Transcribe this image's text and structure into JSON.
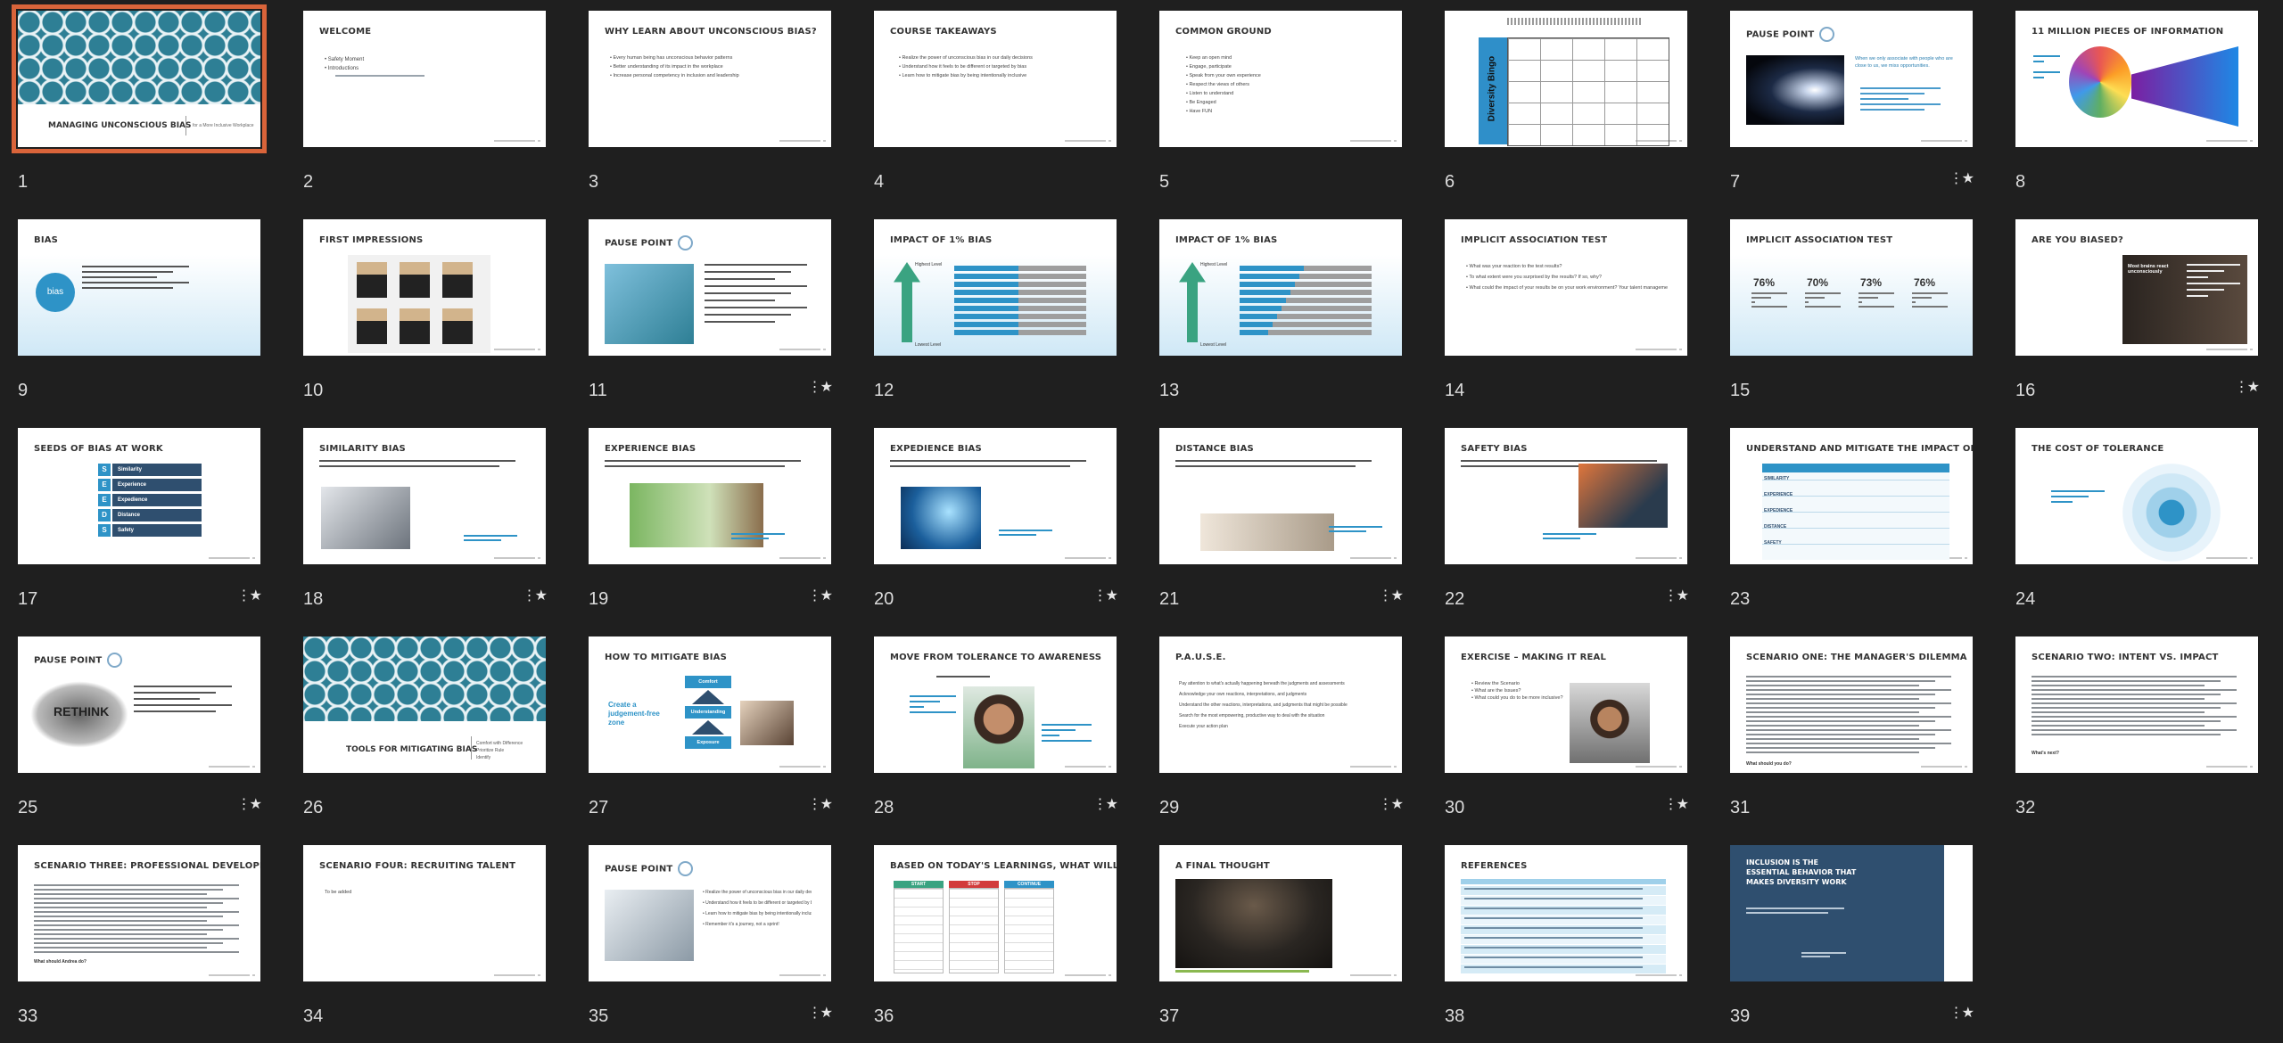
{
  "selected_slide": 1,
  "slides": [
    {
      "n": "1",
      "title": "MANAGING UNCONSCIOUS BIAS",
      "subtitle": "for a More Inclusive Workplace",
      "star": false
    },
    {
      "n": "2",
      "title": "WELCOME",
      "star": false
    },
    {
      "n": "3",
      "title": "WHY LEARN ABOUT UNCONSCIOUS BIAS?",
      "star": false
    },
    {
      "n": "4",
      "title": "COURSE TAKEAWAYS",
      "star": false
    },
    {
      "n": "5",
      "title": "COMMON GROUND",
      "star": false
    },
    {
      "n": "6",
      "title": "Diversity Bingo",
      "star": false
    },
    {
      "n": "7",
      "title": "PAUSE POINT",
      "star": true
    },
    {
      "n": "8",
      "title": "11 MILLION PIECES OF INFORMATION",
      "star": false
    },
    {
      "n": "9",
      "title": "BIAS",
      "star": false
    },
    {
      "n": "10",
      "title": "FIRST IMPRESSIONS",
      "star": false
    },
    {
      "n": "11",
      "title": "PAUSE POINT",
      "star": true
    },
    {
      "n": "12",
      "title": "IMPACT OF 1% BIAS",
      "star": false
    },
    {
      "n": "13",
      "title": "IMPACT OF 1% BIAS",
      "star": false
    },
    {
      "n": "14",
      "title": "IMPLICIT ASSOCIATION TEST",
      "star": false
    },
    {
      "n": "15",
      "title": "IMPLICIT ASSOCIATION TEST",
      "star": false
    },
    {
      "n": "16",
      "title": "ARE YOU BIASED?",
      "star": true
    },
    {
      "n": "17",
      "title": "SEEDS OF BIAS AT WORK",
      "star": true
    },
    {
      "n": "18",
      "title": "SIMILARITY BIAS",
      "star": true
    },
    {
      "n": "19",
      "title": "EXPERIENCE BIAS",
      "star": true
    },
    {
      "n": "20",
      "title": "EXPEDIENCE BIAS",
      "star": true
    },
    {
      "n": "21",
      "title": "DISTANCE BIAS",
      "star": true
    },
    {
      "n": "22",
      "title": "SAFETY BIAS",
      "star": true
    },
    {
      "n": "23",
      "title": "UNDERSTAND AND MITIGATE THE IMPACT OF BIAS",
      "star": false
    },
    {
      "n": "24",
      "title": "THE COST OF TOLERANCE",
      "star": false
    },
    {
      "n": "25",
      "title": "PAUSE POINT",
      "star": true
    },
    {
      "n": "26",
      "title": "TOOLS FOR MITIGATING BIAS",
      "star": false
    },
    {
      "n": "27",
      "title": "HOW TO MITIGATE BIAS",
      "star": true
    },
    {
      "n": "28",
      "title": "MOVE FROM TOLERANCE TO AWARENESS",
      "star": true
    },
    {
      "n": "29",
      "title": "P.A.U.S.E.",
      "star": true
    },
    {
      "n": "30",
      "title": "EXERCISE – MAKING IT REAL",
      "star": true
    },
    {
      "n": "31",
      "title": "SCENARIO ONE: THE MANAGER'S DILEMMA",
      "star": false
    },
    {
      "n": "32",
      "title": "SCENARIO TWO: INTENT VS. IMPACT",
      "star": false
    },
    {
      "n": "33",
      "title": "SCENARIO THREE: PROFESSIONAL DEVELOPMENT",
      "star": false
    },
    {
      "n": "34",
      "title": "SCENARIO FOUR: RECRUITING TALENT",
      "star": false
    },
    {
      "n": "35",
      "title": "PAUSE POINT",
      "star": true
    },
    {
      "n": "36",
      "title": "BASED ON TODAY'S LEARNINGS, WHAT WILL YOU…",
      "star": false
    },
    {
      "n": "37",
      "title": "A FINAL THOUGHT",
      "star": false
    },
    {
      "n": "38",
      "title": "REFERENCES",
      "star": false
    },
    {
      "n": "39",
      "title": "INCLUSION IS THE ESSENTIAL BEHAVIOR THAT MAKES DIVERSITY WORK",
      "star": true
    }
  ],
  "details": {
    "seeds": [
      "Similarity",
      "Experience",
      "Expedience",
      "Distance",
      "Safety"
    ],
    "iat_stats": [
      "76%",
      "70%",
      "73%",
      "76%"
    ],
    "impact_labels": {
      "high": "Highest Level",
      "low": "Lowest Level"
    },
    "mitigate_steps": [
      "Comfort",
      "Understanding",
      "Exposure"
    ],
    "mitigate_side": "Create a judgement-free zone",
    "s7_text": "When we only associate with people who are close to us, we miss opportunities.",
    "s2_text": [
      "Safety Moment",
      "Introductions"
    ],
    "s34_text": "To be added",
    "s32_text": "What's next?",
    "s31_text": "What should you do?",
    "s33_text": "What should Andrea do?",
    "s36_cols": [
      "START",
      "STOP",
      "CONTINUE"
    ],
    "s5_items": [
      "Keep an open mind",
      "Engage, participate",
      "Speak from your own experience",
      "Respect the views of others",
      "Listen to understand",
      "Be Engaged",
      "Have FUN"
    ],
    "s4_items": [
      "Realize the power of unconscious bias in our daily decisions",
      "Understand how it feels to be different or targeted by bias",
      "Learn how to mitigate bias by being intentionally inclusive"
    ],
    "s3_items": [
      "Every human being has unconscious behavior patterns",
      "Better understanding of its impact in the workplace",
      "Increase personal competency in inclusion and leadership"
    ],
    "s14_items": [
      "What was your reaction to the test results?",
      "To what extent were you surprised by the results? If so, why?",
      "What could the impact of your results be on your work environment? Your talent management processes?"
    ],
    "s29_items": [
      "Pay attention to what's actually happening beneath the judgments and assessments",
      "Acknowledge your own reactions, interpretations, and judgments",
      "Understand the other reactions, interpretations, and judgments that might be possible",
      "Search for the most empowering, productive way to deal with the situation",
      "Execute your action plan"
    ],
    "s26_sub": "Comfort with Difference\nPrioritize Rule\nIdentify",
    "s16_text": "Most brains react unconsciously",
    "colors": {
      "teal": "#2e7f95",
      "navy": "#2f4f6f",
      "accent": "#d9643a",
      "lightblue": "#e6f3f9",
      "bar": "#2e93c7"
    }
  }
}
